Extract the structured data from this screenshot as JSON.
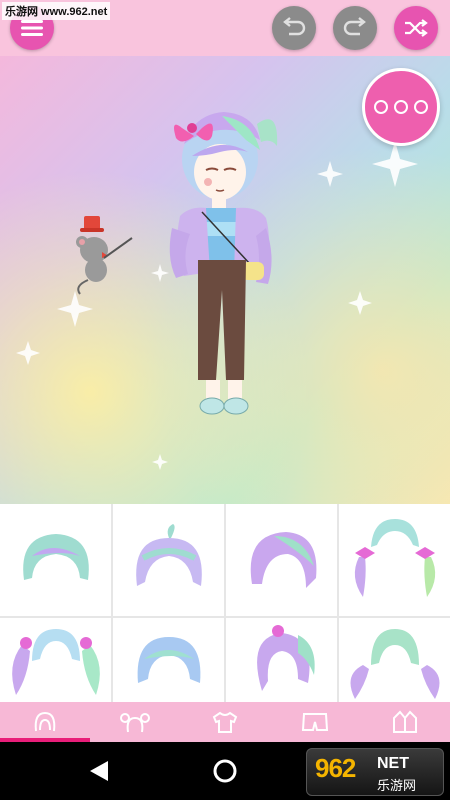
{
  "watermark": {
    "text": "乐游网 www.962.net"
  },
  "toolbar": {
    "menu_icon": "list-icon",
    "undo_icon": "undo-icon",
    "redo_icon": "redo-icon",
    "random_icon": "shuffle-icon",
    "more_icon": "more-dots-icon"
  },
  "colors": {
    "accent_pink": "#e754b0",
    "disabled_grey": "#8b8b8b",
    "tab_bar": "#f7b8d6",
    "tab_indicator": "#e91e79"
  },
  "hair_grid": {
    "items": [
      "hair-bob-bangs",
      "hair-ahoge-bob",
      "hair-side-swept",
      "hair-twin-tails-bows",
      "hair-pigtails-bows",
      "hair-short-bob",
      "hair-side-ponytail",
      "hair-long-twin-tails"
    ]
  },
  "tabs": [
    {
      "icon": "hair-icon",
      "active": true
    },
    {
      "icon": "hair-accessory-icon",
      "active": false
    },
    {
      "icon": "shirt-icon",
      "active": false
    },
    {
      "icon": "shorts-icon",
      "active": false
    },
    {
      "icon": "jacket-icon",
      "active": false
    }
  ],
  "system_nav": {
    "back_icon": "back-triangle-icon",
    "home_icon": "home-circle-icon"
  },
  "site_logo": {
    "big": "962",
    "net": "NET",
    "cn": "乐游网"
  }
}
